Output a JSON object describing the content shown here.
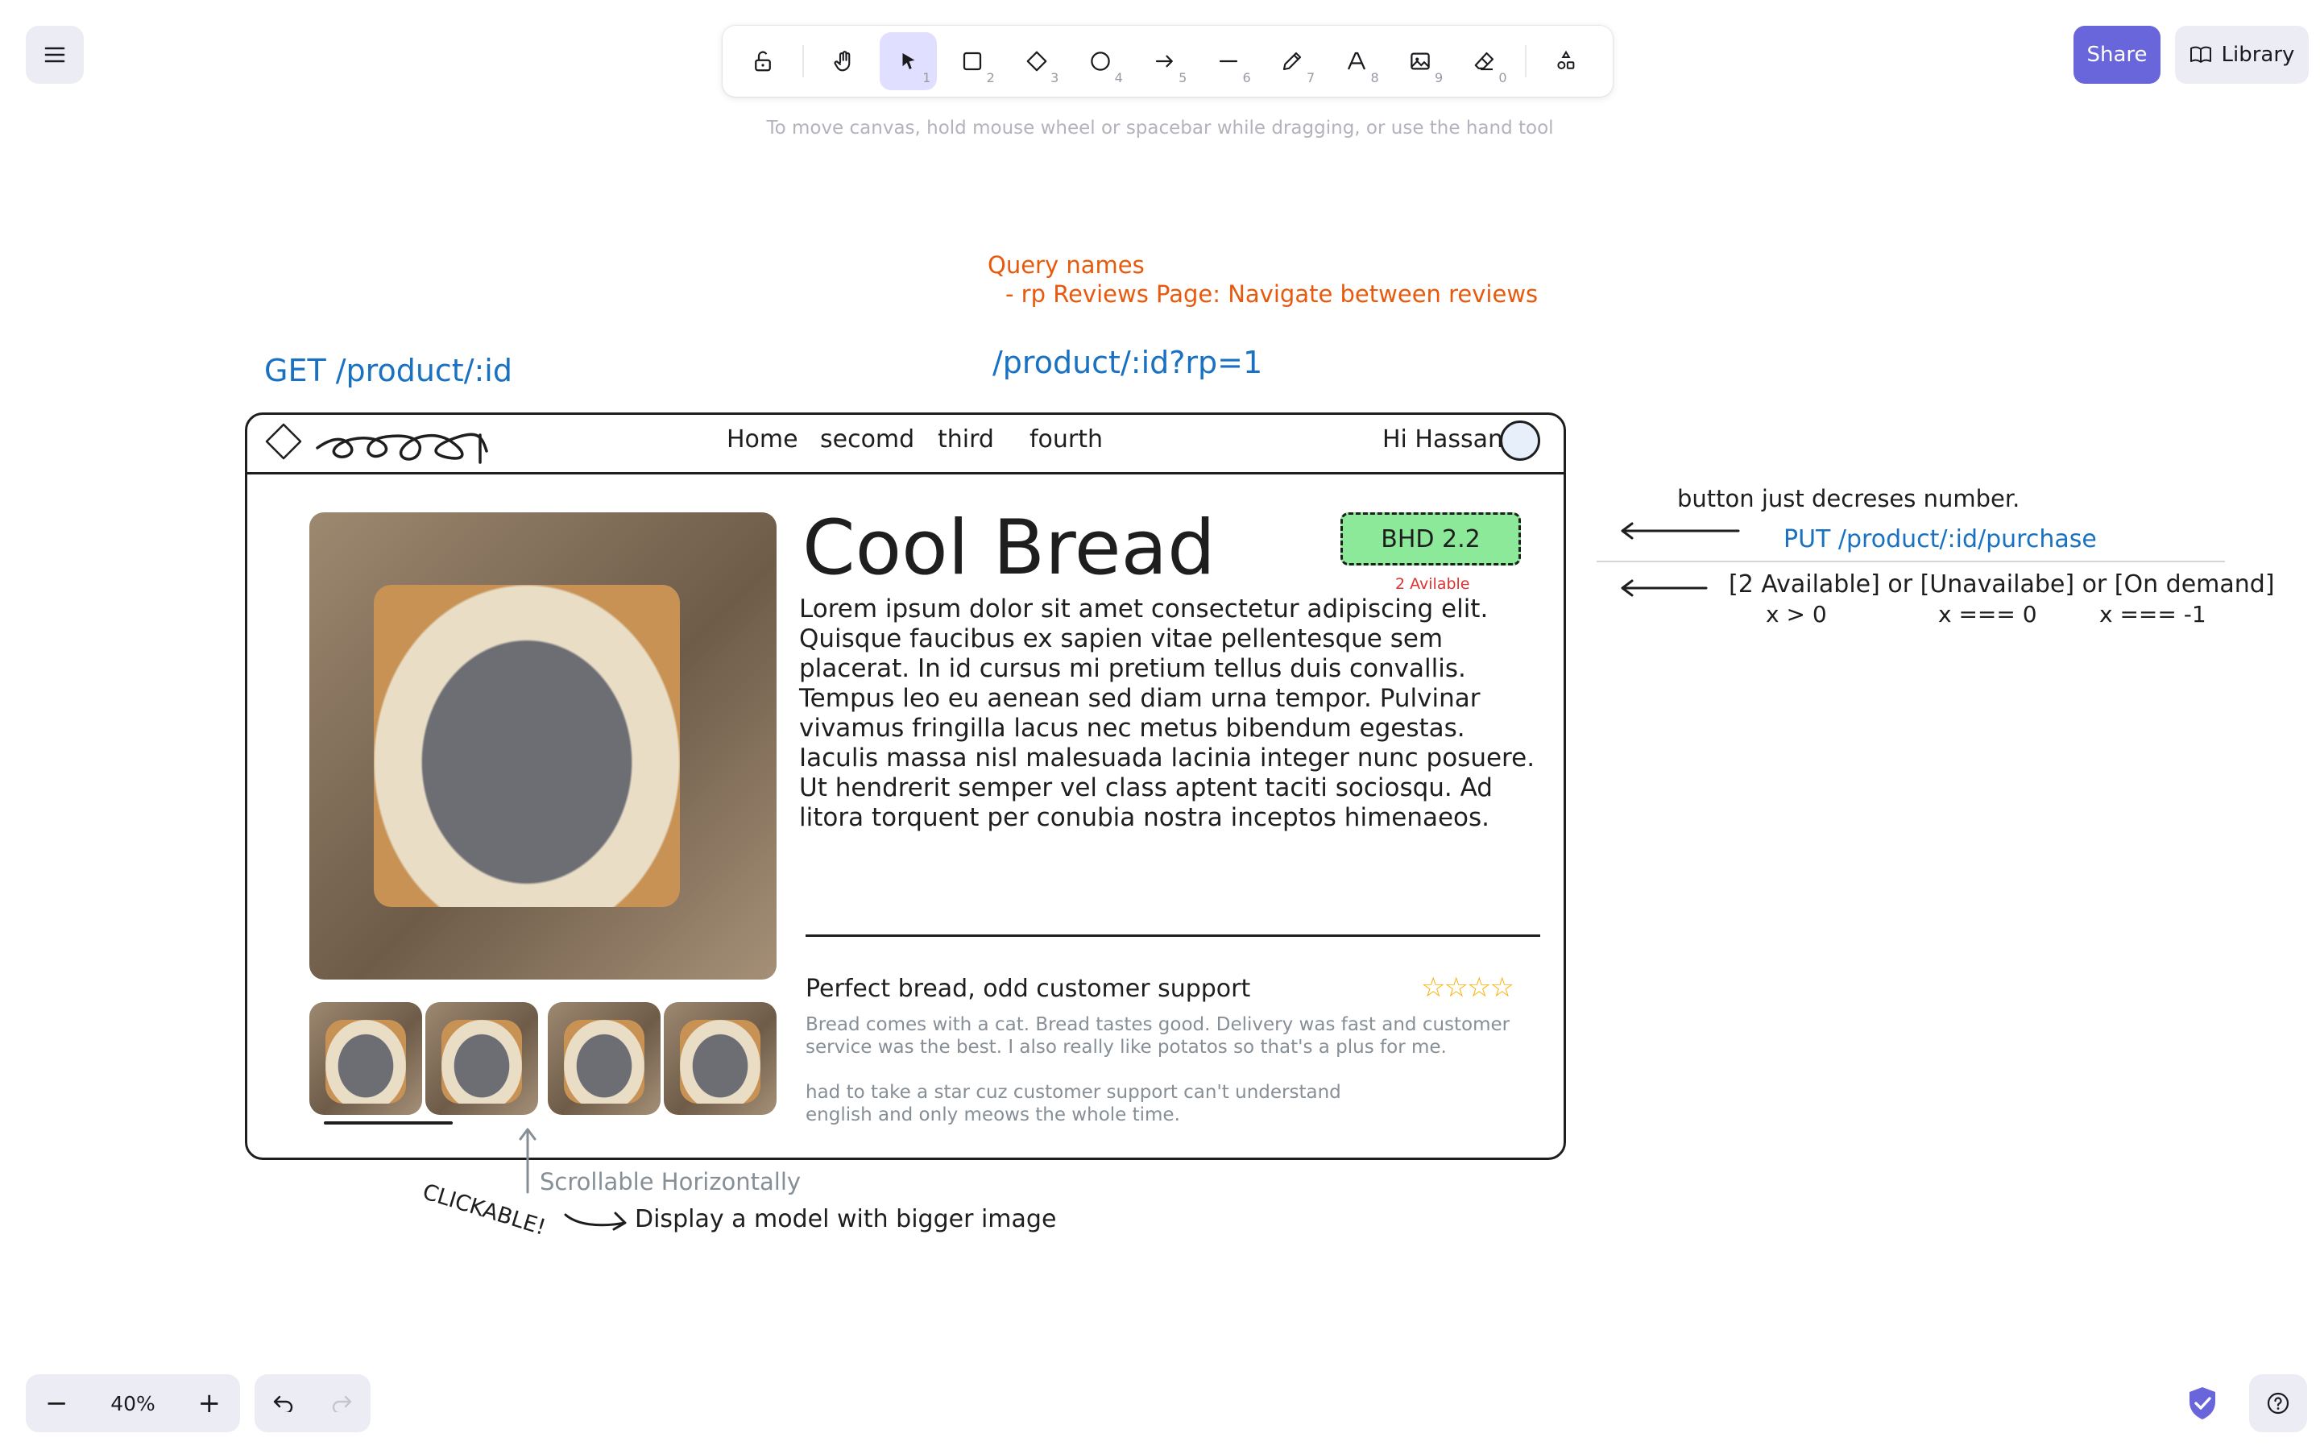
{
  "toolbar": {
    "tools": [
      {
        "name": "lock",
        "key": ""
      },
      {
        "name": "hand",
        "key": ""
      },
      {
        "name": "selection",
        "key": "1"
      },
      {
        "name": "rectangle",
        "key": "2"
      },
      {
        "name": "diamond",
        "key": "3"
      },
      {
        "name": "ellipse",
        "key": "4"
      },
      {
        "name": "arrow",
        "key": "5"
      },
      {
        "name": "line",
        "key": "6"
      },
      {
        "name": "draw",
        "key": "7"
      },
      {
        "name": "text",
        "key": "8"
      },
      {
        "name": "image",
        "key": "9"
      },
      {
        "name": "eraser",
        "key": "0"
      }
    ],
    "hint": "To move canvas, hold mouse wheel or spacebar while dragging, or use the hand tool"
  },
  "header": {
    "share_label": "Share",
    "library_label": "Library"
  },
  "footer": {
    "zoom": "40%"
  },
  "annotations": {
    "query_title": "Query names",
    "query_item": "- rp Reviews Page: Navigate between reviews",
    "route_query": "/product/:id?rp=1",
    "get_route": "GET /product/:id",
    "button_note": "button just decreses number.",
    "put_route": "PUT /product/:id/purchase",
    "availability": "[2 Available] or [Unavailabe] or [On demand]",
    "cond1": "x > 0",
    "cond2": "x === 0",
    "cond3": "x === -1",
    "scroll_note": "Scrollable Horizontally",
    "clickable": "CLICKABLE!",
    "modal_note": "Display a model with bigger image"
  },
  "mockup": {
    "nav": [
      "Home",
      "secomd",
      "third",
      "fourth"
    ],
    "greeting": "Hi Hassan",
    "title": "Cool Bread",
    "price": "BHD 2.2",
    "stock": "2 Avilable",
    "description": "Lorem ipsum dolor sit amet consectetur adipiscing elit. Quisque faucibus ex sapien vitae pellentesque sem placerat. In id cursus mi pretium tellus duis convallis. Tempus leo eu aenean sed diam urna tempor. Pulvinar vivamus fringilla lacus nec metus bibendum egestas. Iaculis massa nisl malesuada lacinia integer nunc posuere. Ut hendrerit semper vel class aptent taciti sociosqu. Ad litora torquent per conubia nostra inceptos himenaeos.",
    "review_title": "Perfect bread, odd customer support",
    "review_rating": 4,
    "review_p1": "Bread comes with a cat. Bread tastes good. Delivery was fast and customer service was the best. I also really like potatos so that's a plus for me.",
    "review_p2": "had to take a star cuz customer support can't understand english and only meows the whole time."
  },
  "colors": {
    "accent": "#6965db",
    "orange": "#e8590c",
    "blue": "#1971c2",
    "price_bg": "#8ce99a",
    "stock": "#e03131"
  }
}
